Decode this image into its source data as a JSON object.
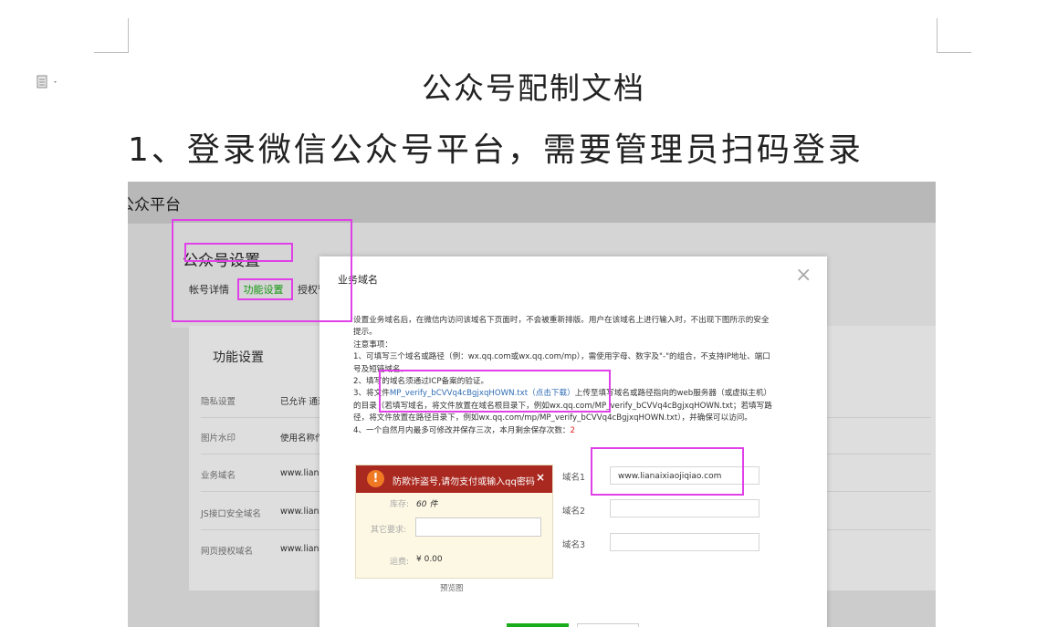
{
  "document": {
    "title": "公众号配制文档",
    "heading1": "1、登录微信公众号平台，需要管理员扫码登录"
  },
  "screenshot": {
    "platform_title": "公众平台",
    "settings_title": "公众号设置",
    "tabs": [
      "帐号详情",
      "功能设置",
      "授权管"
    ],
    "active_tab": "功能设置",
    "section_title": "功能设置",
    "rows": [
      {
        "label": "隐私设置",
        "value": "已允许 通过"
      },
      {
        "label": "图片水印",
        "value": "使用名称作"
      },
      {
        "label": "业务域名",
        "value": "www.liana"
      },
      {
        "label": "JS接口安全域名",
        "value": "www.liana"
      },
      {
        "label": "网页授权域名",
        "value": "www.liana"
      }
    ]
  },
  "modal": {
    "title": "业务域名",
    "close_icon": "×",
    "intro_1": "设置业务域名后，在微信内访问该域名下页面时，不会被重新排版。用户在该域名上进行输入时，不出现下图所示的安全",
    "intro_2": "提示。",
    "notes_heading": "注意事项：",
    "note1_a": "1、可填写三个域名或路径（例：wx.qq.com或wx.qq.com/mp），需使用字母、数字及\"-\"的组合，不支持IP地址、端口",
    "note1_b": "号及短链域名。",
    "note2": "2、填写的域名须通过ICP备案的验证。",
    "note3_prefix": "3、将文件",
    "note3_file": "MP_verify_bCVVq4cBgjxqHOWN.txt",
    "note3_download": "（点击下载）",
    "note3_suffix": "上传至填写域名或路径指向的web服务器（或虚拟主机）",
    "note3_line2": "的目录（若填写域名，将文件放置在域名根目录下，例如wx.qq.com/MP_verify_bCVVq4cBgjxqHOWN.txt；若填写路",
    "note3_line3": "径，将文件放置在路径目录下，例如wx.qq.com/mp/MP_verify_bCVVq4cBgjxqHOWN.txt），并确保可以访问。",
    "note4_text": "4、一个自然月内最多可修改并保存三次，本月剩余保存次数：",
    "note4_count": "2",
    "preview": {
      "alert_text": "防欺诈盗号,请勿支付或输入qq密码",
      "alert_close": "×",
      "stock_label": "库存:",
      "stock_value": "60 件",
      "other_label": "其它要求:",
      "shipping_label": "运费:",
      "shipping_value": "¥ 0.00",
      "caption": "预览图"
    },
    "domains": [
      {
        "label": "域名1",
        "value": "www.lianaixiaojiqiao.com"
      },
      {
        "label": "域名2",
        "value": ""
      },
      {
        "label": "域名3",
        "value": ""
      }
    ]
  },
  "colors": {
    "highlight": "#e040e8",
    "accent_green": "#1aad19",
    "alert_red": "#a9281f",
    "link_blue": "#2f6cb5"
  }
}
